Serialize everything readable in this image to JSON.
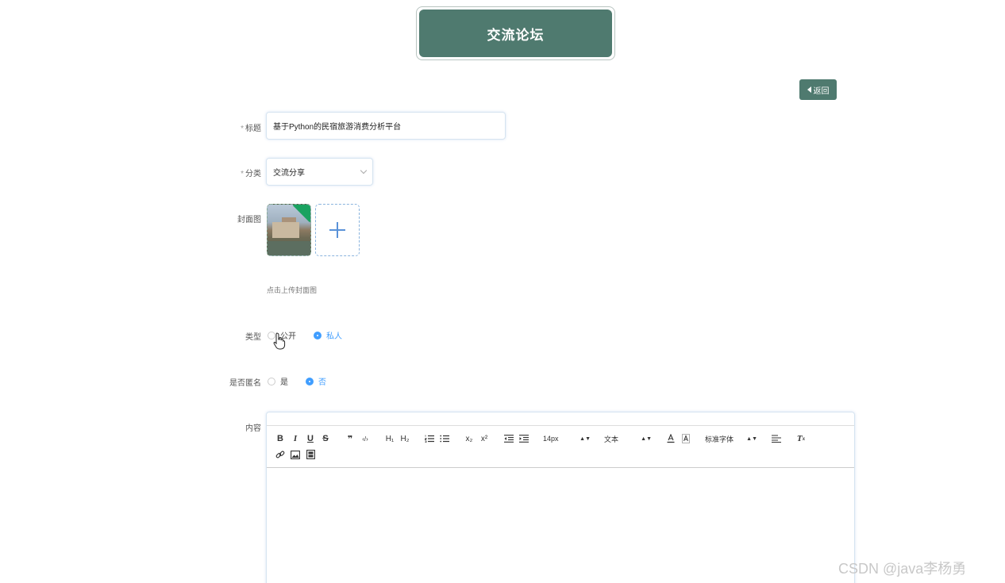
{
  "header": {
    "title": "交流论坛"
  },
  "back_button": {
    "label": "返回"
  },
  "form": {
    "title": {
      "label": "标题",
      "required_mark": "*",
      "value": "基于Python的民宿旅游消费分析平台"
    },
    "category": {
      "label": "分类",
      "required_mark": "*",
      "value": "交流分享"
    },
    "cover": {
      "label": "封面图",
      "hint": "点击上传封面图"
    },
    "type": {
      "label": "类型",
      "options": [
        "公开",
        "私人"
      ],
      "selected": "私人"
    },
    "anonymous": {
      "label": "是否匿名",
      "options": [
        "是",
        "否"
      ],
      "selected": "否"
    },
    "content": {
      "label": "内容"
    }
  },
  "editor": {
    "toolbar": {
      "bold": "B",
      "italic": "I",
      "underline": "U",
      "strike": "S",
      "quote": "❞",
      "code": "‹/›",
      "h1": "H₁",
      "h2": "H₂",
      "sub": "x₂",
      "sup": "x²",
      "font_size": "14px",
      "text_type": "文本",
      "font_family": "标准字体",
      "clean": "Tx"
    }
  },
  "watermark": "CSDN @java李杨勇"
}
